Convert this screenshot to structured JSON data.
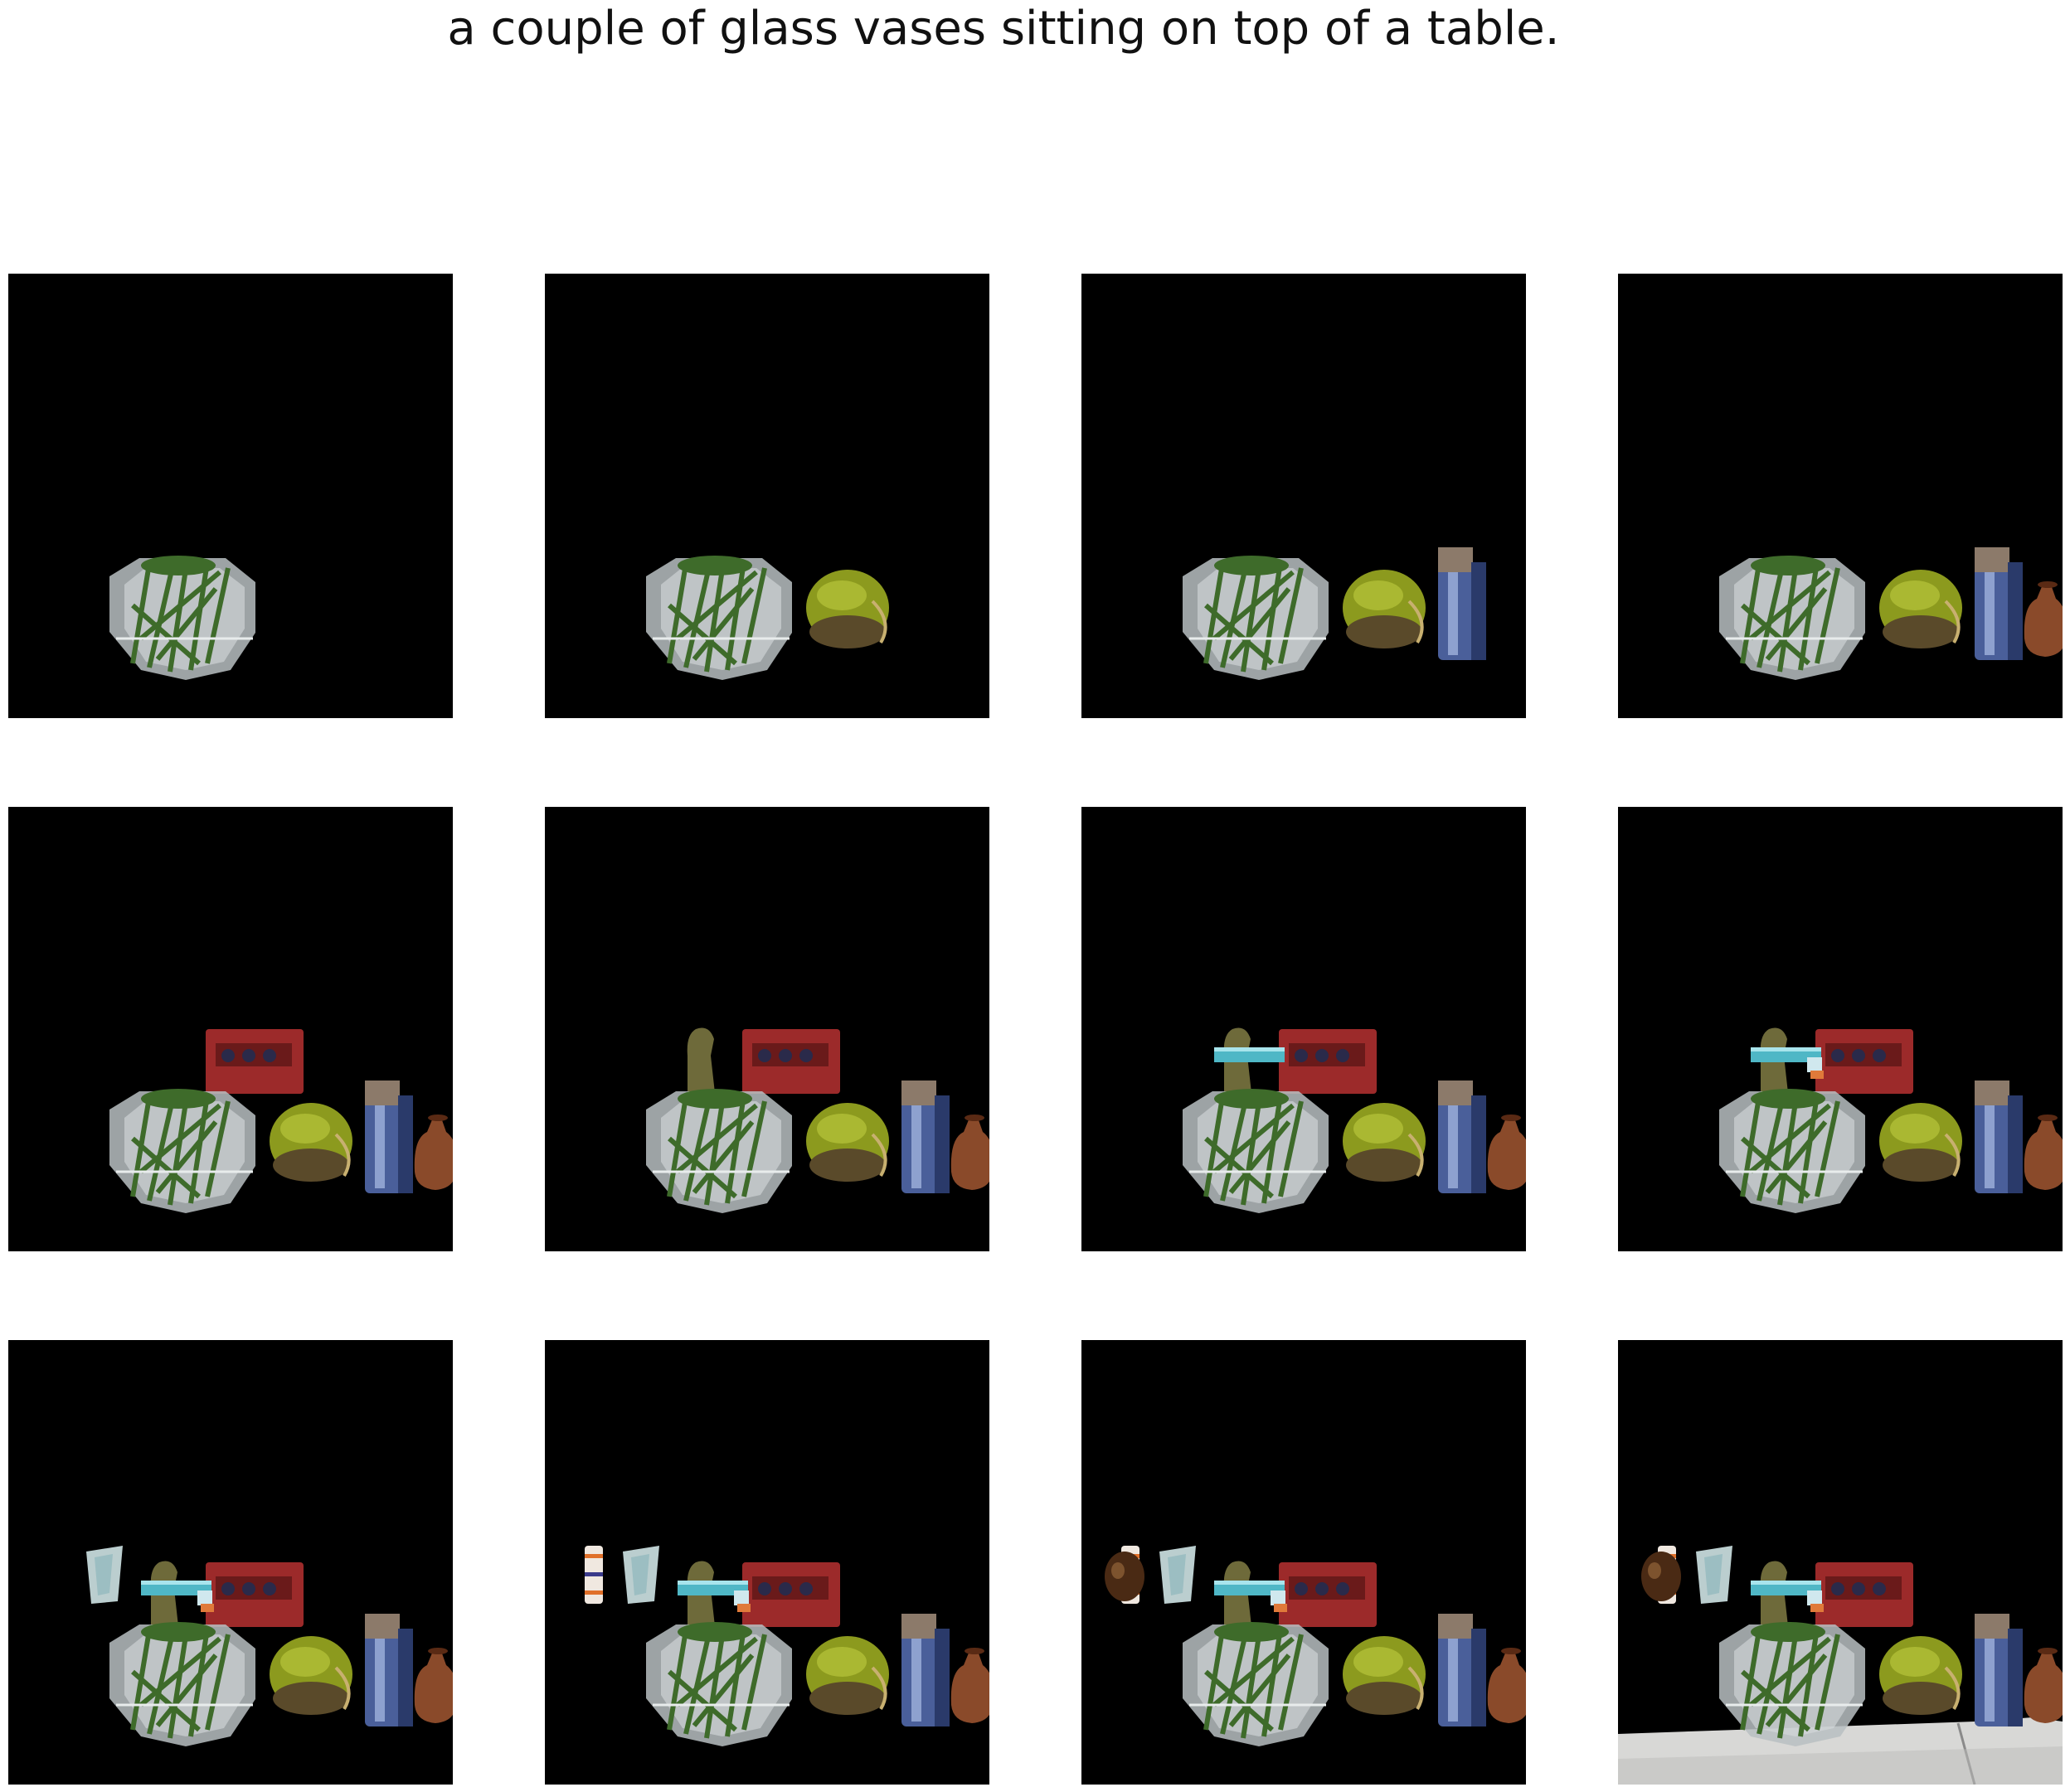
{
  "figure": {
    "caption": "a couple of glass vases sitting on top of a table.",
    "background": "#000000",
    "frame_count": 12
  },
  "frames": [
    {
      "step": 1,
      "objects": [
        "fishbowl-vase"
      ]
    },
    {
      "step": 2,
      "objects": [
        "fishbowl-vase",
        "green-round-vase"
      ]
    },
    {
      "step": 3,
      "objects": [
        "fishbowl-vase",
        "green-round-vase",
        "blue-glass-jar"
      ]
    },
    {
      "step": 4,
      "objects": [
        "fishbowl-vase",
        "green-round-vase",
        "blue-glass-jar",
        "brown-jug"
      ]
    },
    {
      "step": 5,
      "objects": [
        "fishbowl-vase",
        "green-round-vase",
        "blue-glass-jar",
        "brown-jug",
        "red-pot"
      ]
    },
    {
      "step": 6,
      "objects": [
        "fishbowl-vase",
        "green-round-vase",
        "blue-glass-jar",
        "brown-jug",
        "red-pot",
        "olive-figure"
      ]
    },
    {
      "step": 7,
      "objects": [
        "fishbowl-vase",
        "green-round-vase",
        "blue-glass-jar",
        "brown-jug",
        "red-pot",
        "olive-figure",
        "teal-cylinder"
      ]
    },
    {
      "step": 8,
      "objects": [
        "fishbowl-vase",
        "green-round-vase",
        "blue-glass-jar",
        "brown-jug",
        "red-pot",
        "olive-figure",
        "teal-cylinder",
        "small-striped-piece"
      ]
    },
    {
      "step": 9,
      "objects": [
        "fishbowl-vase",
        "green-round-vase",
        "blue-glass-jar",
        "brown-jug",
        "red-pot",
        "olive-figure",
        "teal-cylinder",
        "small-striped-piece",
        "clear-glass-vase"
      ]
    },
    {
      "step": 10,
      "objects": [
        "fishbowl-vase",
        "green-round-vase",
        "blue-glass-jar",
        "brown-jug",
        "red-pot",
        "olive-figure",
        "teal-cylinder",
        "small-striped-piece",
        "clear-glass-vase",
        "striped-vase"
      ]
    },
    {
      "step": 11,
      "objects": [
        "fishbowl-vase",
        "green-round-vase",
        "blue-glass-jar",
        "brown-jug",
        "red-pot",
        "olive-figure",
        "teal-cylinder",
        "small-striped-piece",
        "clear-glass-vase",
        "striped-vase",
        "dark-brown-jug"
      ]
    },
    {
      "step": 12,
      "objects": [
        "fishbowl-vase",
        "green-round-vase",
        "blue-glass-jar",
        "brown-jug",
        "red-pot",
        "olive-figure",
        "teal-cylinder",
        "small-striped-piece",
        "clear-glass-vase",
        "striped-vase",
        "dark-brown-jug",
        "table-surface"
      ]
    }
  ],
  "colors": {
    "glass": "#b9c0c2",
    "leaves": "#3e6b2a",
    "green_vase": "#8c9a1e",
    "blue_jar": "#4a5f9a",
    "brown_jug": "#8a4a2a",
    "red_pot": "#9c2a2a",
    "olive": "#6e6a3a",
    "teal": "#4fb7c6",
    "table": "#d8d8d6"
  }
}
